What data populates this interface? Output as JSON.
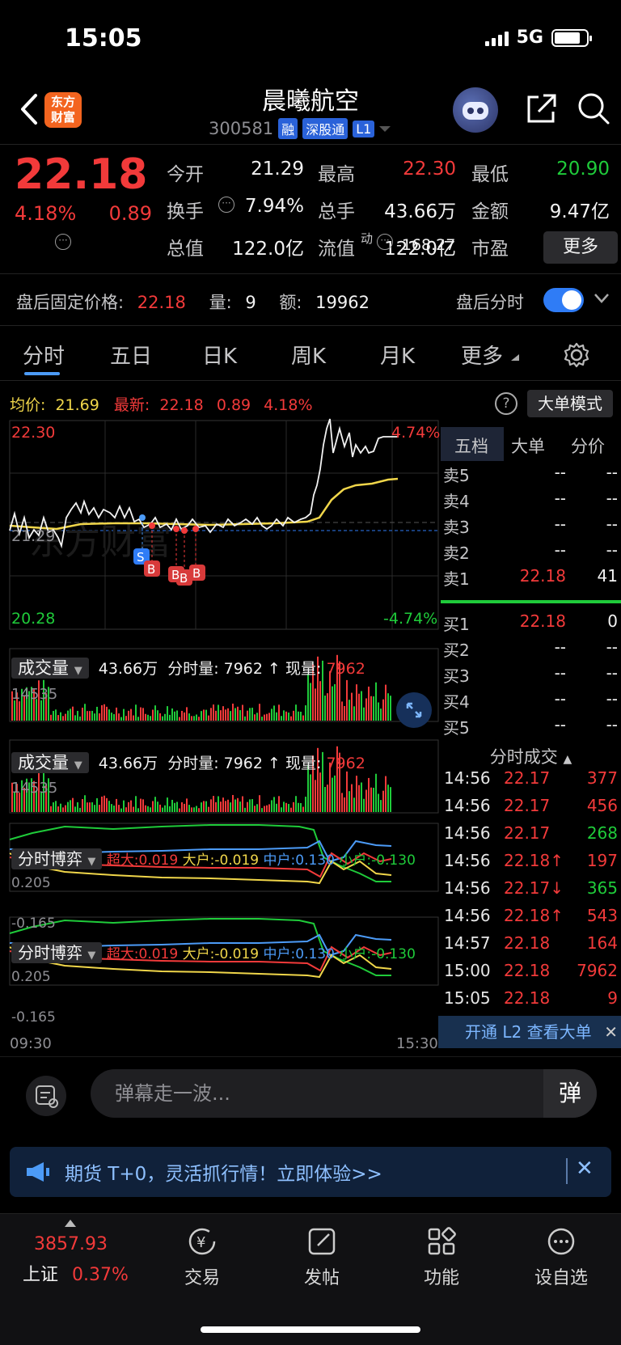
{
  "status_bar": {
    "time": "15:05",
    "network": "5G"
  },
  "header": {
    "logo_text_line1": "东方",
    "logo_text_line2": "财富",
    "stock_name": "晨曦航空",
    "stock_code": "300581",
    "tags": [
      "融",
      "深股通",
      "L1"
    ]
  },
  "quote": {
    "price": "22.18",
    "change_pct": "4.18%",
    "change_amt": "0.89",
    "rows": [
      [
        {
          "label": "今开",
          "value": "21.29",
          "color": "white"
        },
        {
          "label": "最高",
          "value": "22.30",
          "color": "red"
        },
        {
          "label": "最低",
          "value": "20.90",
          "color": "green"
        }
      ],
      [
        {
          "label": "换手",
          "value": "7.94%",
          "color": "white"
        },
        {
          "label": "总手",
          "value": "43.66万",
          "color": "white"
        },
        {
          "label": "金额",
          "value": "9.47亿",
          "color": "white"
        }
      ],
      [
        {
          "label": "总值",
          "value": "122.0亿",
          "color": "white"
        },
        {
          "label": "流值",
          "value": "122.0亿",
          "color": "white"
        },
        {
          "label": "市盈",
          "value": "-168.27",
          "color": "white"
        }
      ]
    ],
    "pe_superscript": "动",
    "more_label": "更多"
  },
  "after_hours": {
    "label": "盘后固定价格:",
    "price": "22.18",
    "vol_label": "量:",
    "vol": "9",
    "amount_label": "额:",
    "amount": "19962",
    "toggle_label": "盘后分时",
    "toggle_on": true
  },
  "tabs": [
    "分时",
    "五日",
    "日K",
    "周K",
    "月K",
    "更多"
  ],
  "active_tab": "分时",
  "chart_legend": {
    "avg_label": "均价:",
    "avg_value": "21.69",
    "latest_label": "最新:",
    "latest_value": "22.18",
    "latest_chg": "0.89",
    "latest_pct": "4.18%",
    "big_order_label": "大单模式",
    "help_glyph": "?"
  },
  "price_axis": {
    "high": "22.30",
    "low": "20.28",
    "mid": "21.29",
    "high_pct": "4.74%",
    "low_pct": "-4.74%"
  },
  "trade_markers": [
    "S",
    "B",
    "B",
    "B",
    "B"
  ],
  "volume_panels": [
    {
      "title": "成交量",
      "total": "43.66万",
      "tick_label": "分时量: 7962 ↑ 现量:",
      "tick_value": "7962",
      "max": "14535"
    },
    {
      "title": "成交量",
      "total": "43.66万",
      "tick_label": "分时量: 7962 ↑ 现量:",
      "tick_value": "7962",
      "max": "14535"
    }
  ],
  "game_panels": [
    {
      "title": "分时博弈",
      "super_label": "超大:",
      "super": "0.019",
      "big_label": "大户:",
      "big": "-0.019",
      "mid_label": "中户:",
      "mid": "0.130",
      "small_label": "小户:",
      "small": "-0.130",
      "max": "0.205",
      "min": "-0.165"
    },
    {
      "title": "分时博弈",
      "super_label": "超大:",
      "super": "0.019",
      "big_label": "大户:",
      "big": "-0.019",
      "mid_label": "中户:",
      "mid": "0.130",
      "small_label": "小户:",
      "small": "-0.130",
      "max": "0.205",
      "min": "-0.165"
    }
  ],
  "time_axis": {
    "start": "09:30",
    "end": "15:30"
  },
  "order_book": {
    "tabs": [
      "五档",
      "大单",
      "分价"
    ],
    "asks": [
      {
        "label": "卖5",
        "price": "--",
        "vol": "--"
      },
      {
        "label": "卖4",
        "price": "--",
        "vol": "--"
      },
      {
        "label": "卖3",
        "price": "--",
        "vol": "--"
      },
      {
        "label": "卖2",
        "price": "--",
        "vol": "--"
      },
      {
        "label": "卖1",
        "price": "22.18",
        "vol": "41"
      }
    ],
    "bids": [
      {
        "label": "买1",
        "price": "22.18",
        "vol": "0"
      },
      {
        "label": "买2",
        "price": "--",
        "vol": "--"
      },
      {
        "label": "买3",
        "price": "--",
        "vol": "--"
      },
      {
        "label": "买4",
        "price": "--",
        "vol": "--"
      },
      {
        "label": "买5",
        "price": "--",
        "vol": "--"
      }
    ]
  },
  "ticks": {
    "title": "分时成交",
    "rows": [
      {
        "time": "14:56",
        "price": "22.17",
        "vol": "377",
        "pc": "red",
        "vc": "red"
      },
      {
        "time": "14:56",
        "price": "22.17",
        "vol": "456",
        "pc": "red",
        "vc": "red"
      },
      {
        "time": "14:56",
        "price": "22.17",
        "vol": "268",
        "pc": "red",
        "vc": "green"
      },
      {
        "time": "14:56",
        "price": "22.18↑",
        "vol": "197",
        "pc": "red",
        "vc": "red"
      },
      {
        "time": "14:56",
        "price": "22.17↓",
        "vol": "365",
        "pc": "red",
        "vc": "green"
      },
      {
        "time": "14:56",
        "price": "22.18↑",
        "vol": "543",
        "pc": "red",
        "vc": "red"
      },
      {
        "time": "14:57",
        "price": "22.18",
        "vol": "164",
        "pc": "red",
        "vc": "red"
      },
      {
        "time": "15:00",
        "price": "22.18",
        "vol": "7962",
        "pc": "red",
        "vc": "red"
      },
      {
        "time": "15:05",
        "price": "22.18",
        "vol": "9",
        "pc": "red",
        "vc": "red"
      }
    ],
    "l2_banner": "开通 L2 查看大单"
  },
  "danmu": {
    "placeholder": "弹幕走一波...",
    "button": "弹"
  },
  "promo": {
    "text": "期货 T+0，灵活抓行情！立即体验>>"
  },
  "bottom_nav": {
    "index_value": "3857.93",
    "index_name": "上证",
    "index_pct": "0.37%",
    "items": [
      "交易",
      "发帖",
      "功能",
      "设自选"
    ]
  },
  "colors": {
    "up": "#f23a3a",
    "down": "#1fcb3a",
    "avg": "#f0d64a",
    "accent": "#4c9bf7",
    "super": "#f23a3a",
    "big": "#f0d64a",
    "mid": "#4c9bf7",
    "small": "#1fcb3a"
  }
}
